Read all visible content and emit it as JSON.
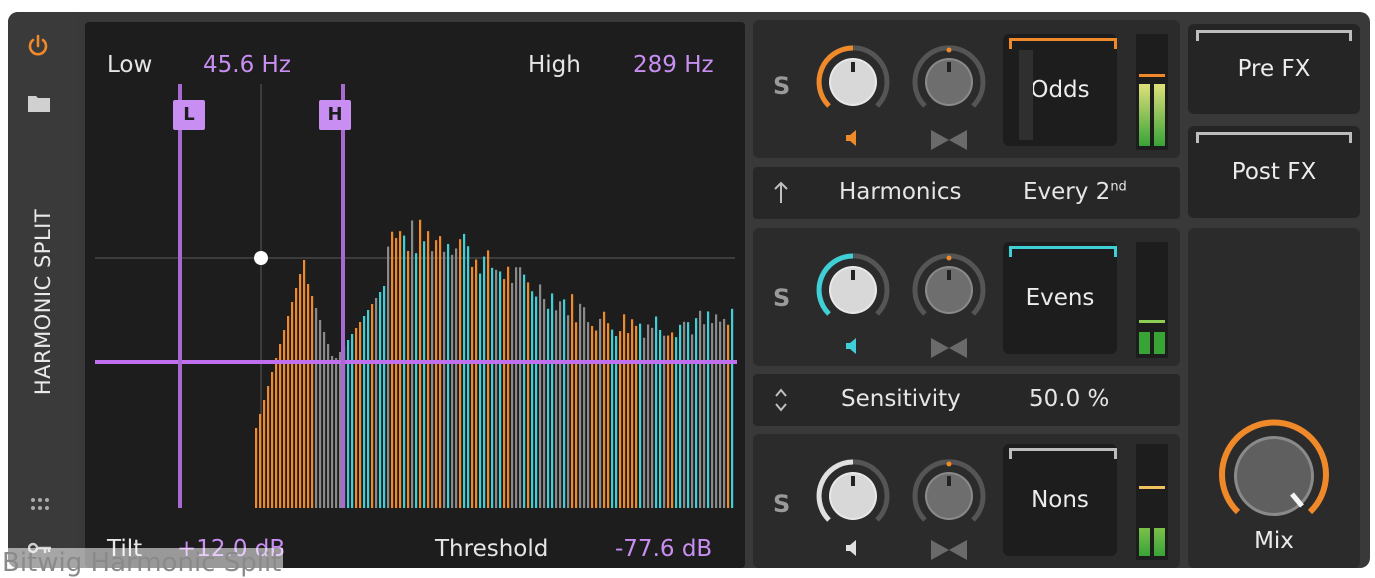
{
  "device": {
    "title": "HARMONIC SPLIT",
    "caption": "Bitwig Harmonic Split"
  },
  "graph": {
    "low_label": "Low",
    "low_value": "45.6 Hz",
    "high_label": "High",
    "high_value": "289 Hz",
    "low_marker": "L",
    "high_marker": "H",
    "tilt_label": "Tilt",
    "tilt_value": "+12.0 dB",
    "threshold_label": "Threshold",
    "threshold_value": "-77.6 dB"
  },
  "bands": [
    {
      "solo": "S",
      "name": "Odds",
      "color": "#f0892a"
    },
    {
      "solo": "S",
      "name": "Evens",
      "color": "#3fcfd6"
    },
    {
      "solo": "S",
      "name": "Nons",
      "color": "#cfcfcf"
    }
  ],
  "harmonics": {
    "icon": "arrow-up-icon",
    "label": "Harmonics",
    "value_main": "Every 2",
    "value_sup": "nd"
  },
  "sensitivity": {
    "icon": "up-down-icon",
    "label": "Sensitivity",
    "value": "50.0 %"
  },
  "routing": {
    "pre_label": "Pre FX",
    "post_label": "Post FX"
  },
  "mix": {
    "label": "Mix",
    "level": 0.85
  },
  "colors": {
    "accent": "#f0892a",
    "violet": "#b66be0",
    "cyan": "#3fcfd6",
    "panel": "#2b2b2b"
  }
}
